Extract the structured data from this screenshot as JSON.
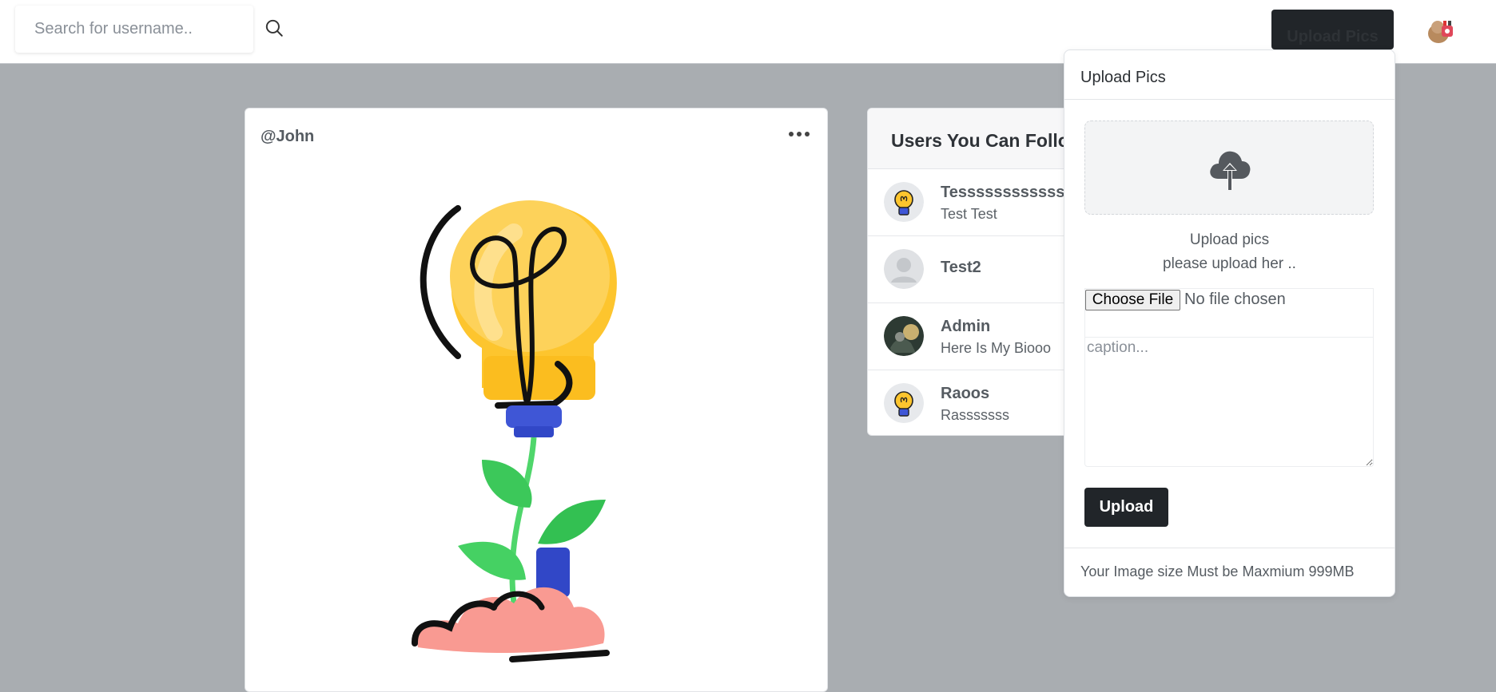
{
  "search": {
    "placeholder": "Search for username.."
  },
  "header": {
    "upload_label": "Upload Pics"
  },
  "post": {
    "username": "@John"
  },
  "suggestions": {
    "title": "Users You Can Follo",
    "users": [
      {
        "name": "Tessssssssssssss",
        "bio": "Test Test"
      },
      {
        "name": "Test2",
        "bio": ""
      },
      {
        "name": "Admin",
        "bio": "Here Is My Biooo"
      },
      {
        "name": "Raoos",
        "bio": "Rasssssss"
      }
    ]
  },
  "upload_panel": {
    "title": "Upload Pics",
    "drop_line1": "Upload pics",
    "drop_line2": "please upload her ..",
    "choose_file_label": "Choose File",
    "no_file_text": "No file chosen",
    "caption_placeholder": "caption...",
    "submit_label": "Upload",
    "footer_note": "Your Image size Must be Maxmium 999MB"
  },
  "colors": {
    "accent_dark": "#212529",
    "background": "#a9adb1"
  }
}
